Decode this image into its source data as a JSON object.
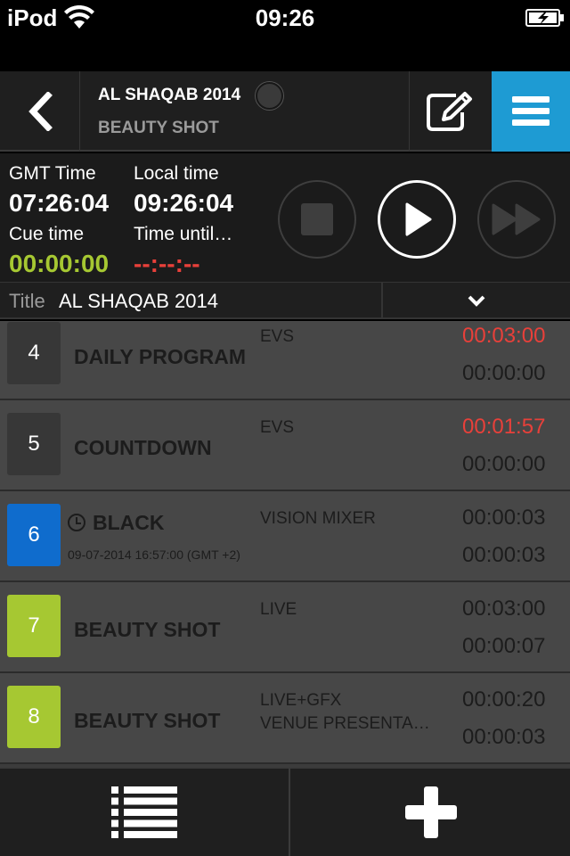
{
  "status_bar": {
    "carrier": "iPod",
    "time": "09:26",
    "icons": [
      "wifi-icon",
      "battery-charging-icon"
    ]
  },
  "header": {
    "title": "AL SHAQAB 2014",
    "subtitle": "BEAUTY SHOT",
    "icons": [
      "back-chevron-icon",
      "edit-icon",
      "menu-icon"
    ],
    "accent_color": "#1e9bd3"
  },
  "timing": {
    "gmt_label": "GMT Time",
    "gmt_value": "07:26:04",
    "local_label": "Local time",
    "local_value": "09:26:04",
    "cue_label": "Cue time",
    "cue_value": "00:00:00",
    "until_label": "Time until…",
    "until_value": "--:--:--",
    "icons": [
      "stop-icon",
      "play-icon",
      "fast-forward-icon"
    ]
  },
  "title_row": {
    "label": "Title",
    "value": "AL SHAQAB 2014",
    "icon": "chevron-down-icon"
  },
  "rows": [
    {
      "num": "4",
      "color": "#373737",
      "name": "DAILY PROGRAM",
      "source": "EVS",
      "source2": "",
      "t1": "00:03:00",
      "t1_red": true,
      "t2": "00:00:00"
    },
    {
      "num": "5",
      "color": "#373737",
      "name": "COUNTDOWN",
      "source": "EVS",
      "source2": "",
      "t1": "00:01:57",
      "t1_red": true,
      "t2": "00:00:00"
    },
    {
      "num": "6",
      "color": "#0f6ccd",
      "name": "BLACK",
      "date": "09-07-2014 16:57:00 (GMT +2)",
      "source": "VISION MIXER",
      "source2": "",
      "t1": "00:00:03",
      "t1_red": false,
      "t2": "00:00:03"
    },
    {
      "num": "7",
      "color": "#a6c832",
      "name": "BEAUTY SHOT",
      "source": "LIVE",
      "source2": "",
      "t1": "00:03:00",
      "t1_red": false,
      "t2": "00:00:07"
    },
    {
      "num": "8",
      "color": "#a6c832",
      "name": "BEAUTY SHOT",
      "source": "LIVE+GFX",
      "source2": "VENUE PRESENTA…",
      "t1": "00:00:20",
      "t1_red": false,
      "t2": "00:00:03"
    }
  ],
  "bottom_bar": {
    "icons": [
      "list-icon",
      "plus-icon"
    ]
  }
}
